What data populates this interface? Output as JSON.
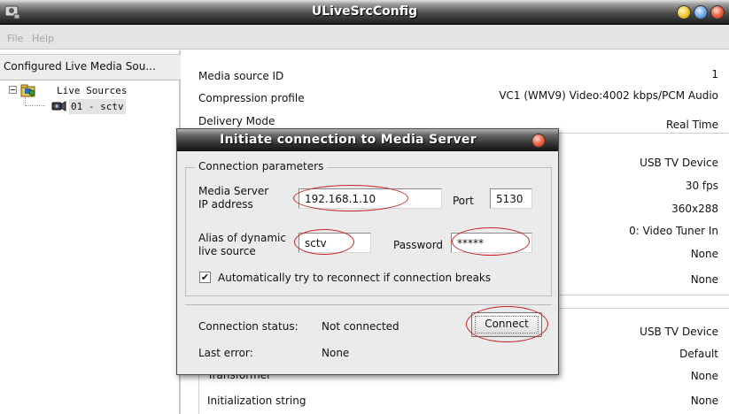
{
  "window": {
    "title": "ULiveSrcConfig"
  },
  "menu": {
    "file": "File",
    "help": "Help"
  },
  "tree": {
    "header": "Configured Live Media Sou...",
    "root_label": "Live Sources",
    "item_label": "01 - sctv"
  },
  "properties": {
    "media_source_id": {
      "label": "Media source ID",
      "value": "1"
    },
    "compression_profile": {
      "label": "Compression profile",
      "value": "VC1 (WMV9) Video:4002 kbps/PCM Audio"
    },
    "delivery_mode": {
      "label": "Delivery Mode",
      "value": "Real Time"
    },
    "video_group_values": [
      "USB TV Device",
      "30 fps",
      "360x288",
      "0: Video Tuner In",
      "None",
      "None"
    ],
    "audio_group_values": [
      "USB TV Device",
      "Default",
      "None",
      "None"
    ],
    "transformer_label": "Transformer",
    "init_string_label": "Initialization string"
  },
  "dialog": {
    "title": "Initiate connection to Media Server",
    "group_legend": "Connection parameters",
    "server_ip_label_line1": "Media Server",
    "server_ip_label_line2": "IP address",
    "server_ip_value": "192.168.1.10",
    "port_label": "Port",
    "port_value": "5130",
    "alias_label_line1": "Alias of dynamic",
    "alias_label_line2": "live source",
    "alias_value": "sctv",
    "password_label": "Password",
    "password_value": "*****",
    "reconnect_label": "Automatically try to reconnect if connection breaks",
    "reconnect_checked": true,
    "status_label": "Connection status:",
    "status_value": "Not connected",
    "last_error_label": "Last error:",
    "last_error_value": "None",
    "connect_button": "Connect"
  },
  "annotations": {
    "highlight_color": "#cc2222"
  },
  "colors": {
    "titlebar_dark": "#1e1e1e",
    "dialog_bg": "#ebebeb",
    "tree_selection": "#e3e3e3"
  }
}
